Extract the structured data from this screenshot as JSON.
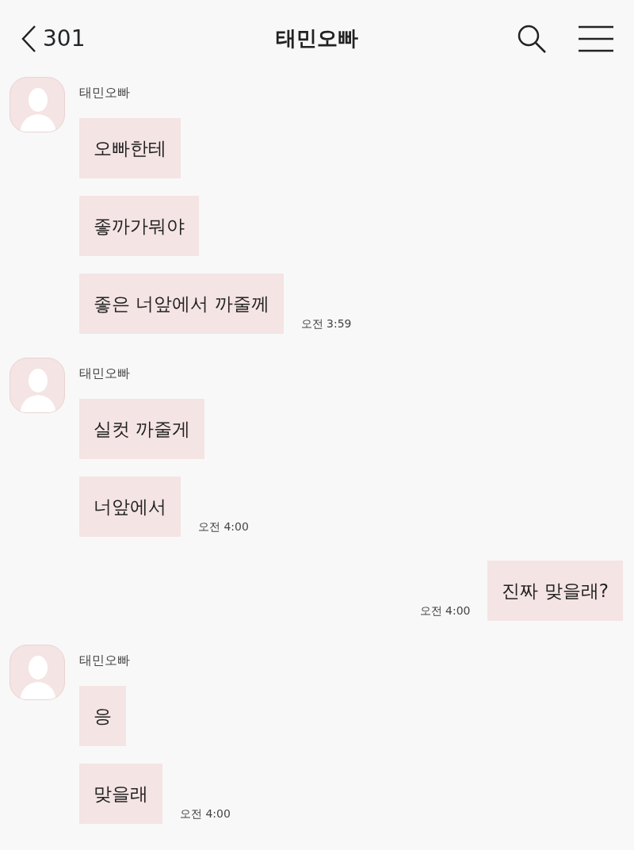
{
  "header": {
    "back_label": "301",
    "title": "태민오빠"
  },
  "messages": [
    {
      "kind": "received",
      "sender": "태민오빠",
      "bubbles": [
        "오빠한테",
        "좋까가뭐야",
        "좋은 너앞에서 까줄께"
      ],
      "time": "오전 3:59"
    },
    {
      "kind": "received",
      "sender": "태민오빠",
      "bubbles": [
        "실컷 까줄게",
        "너앞에서"
      ],
      "time": "오전 4:00"
    },
    {
      "kind": "sent",
      "bubbles": [
        "진짜 맞을래?"
      ],
      "time": "오전 4:00"
    },
    {
      "kind": "received",
      "sender": "태민오빠",
      "bubbles": [
        "응",
        "맞을래"
      ],
      "time": "오전 4:00"
    }
  ]
}
